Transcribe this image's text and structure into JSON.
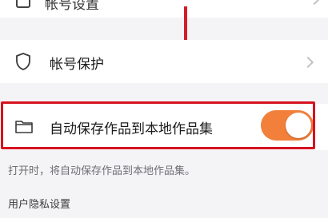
{
  "settings": {
    "top_row": {
      "label": "帐号设置",
      "icon": "settings-icon"
    },
    "account_protection": {
      "label": "帐号保护",
      "icon": "shield-icon"
    },
    "auto_save": {
      "label": "自动保存作品到本地作品集",
      "icon": "folder-icon",
      "enabled": true,
      "toggle_color": "#f2803b",
      "hint": "打开时，将自动保存作品到本地作品集。"
    },
    "privacy_section": {
      "title": "用户隐私设置"
    }
  },
  "annotations": {
    "highlight_color": "#d7121f"
  }
}
